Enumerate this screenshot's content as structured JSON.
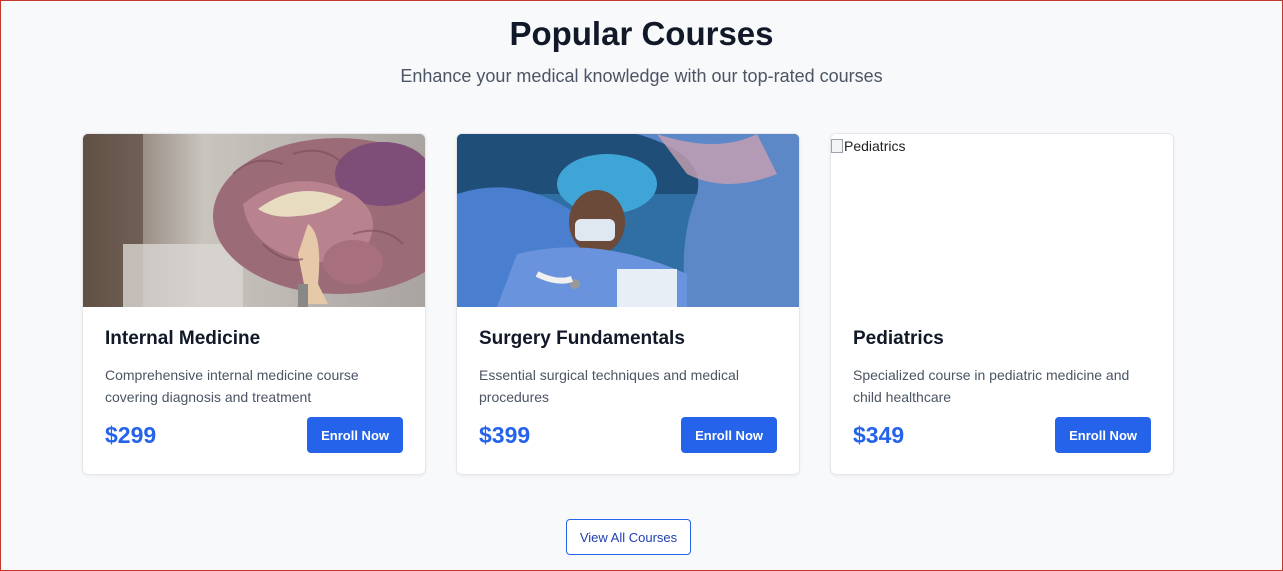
{
  "section": {
    "title": "Popular Courses",
    "subtitle": "Enhance your medical knowledge with our top-rated courses"
  },
  "courses": [
    {
      "title": "Internal Medicine",
      "description": "Comprehensive internal medicine course covering diagnosis and treatment",
      "price": "$299",
      "button": "Enroll Now",
      "image": "brain-model-photo"
    },
    {
      "title": "Surgery Fundamentals",
      "description": "Essential surgical techniques and medical procedures",
      "price": "$399",
      "button": "Enroll Now",
      "image": "surgeon-photo"
    },
    {
      "title": "Pediatrics",
      "description": "Specialized course in pediatric medicine and child healthcare",
      "price": "$349",
      "button": "Enroll Now",
      "image_alt": "Pediatrics"
    }
  ],
  "view_all_label": "View All Courses",
  "colors": {
    "accent": "#2563eb",
    "background": "#f8f9fb",
    "title": "#111827"
  }
}
